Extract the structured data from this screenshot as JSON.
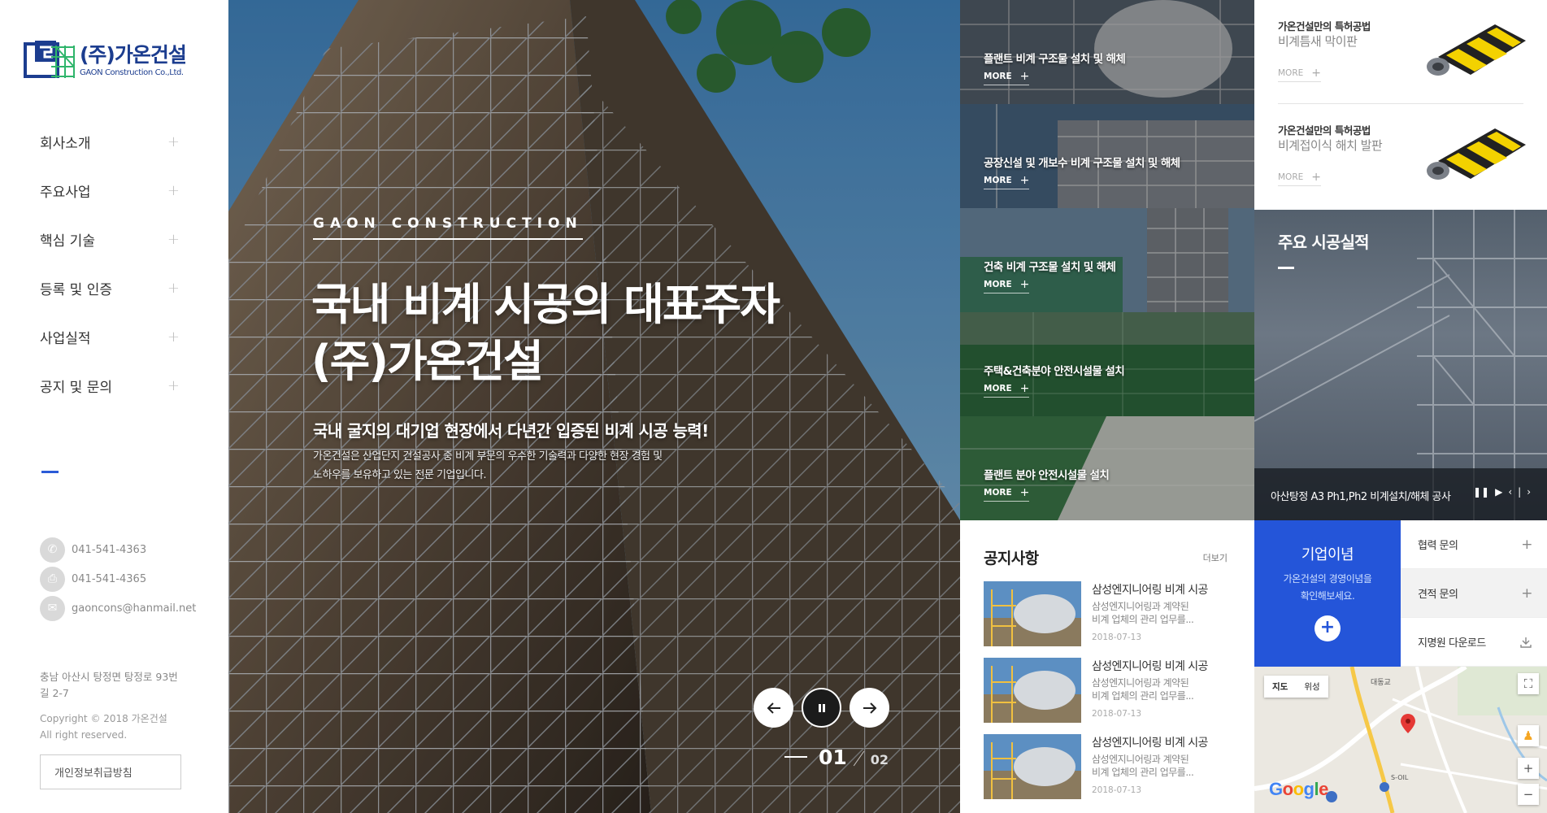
{
  "logo": {
    "name_kr": "(주)가온건설",
    "name_en": "GAON Construction Co.,Ltd."
  },
  "nav": [
    {
      "label": "회사소개"
    },
    {
      "label": "주요사업"
    },
    {
      "label": "핵심 기술"
    },
    {
      "label": "등록 및 인증"
    },
    {
      "label": "사업실적"
    },
    {
      "label": "공지 및 문의"
    }
  ],
  "contacts": {
    "phone": "041-541-4363",
    "fax": "041-541-4365",
    "email": "gaoncons@hanmail.net"
  },
  "address": "충남 아산시 탕정면 탕정로 93번길 2-7",
  "copyright": {
    "line1": "Copyright © 2018 가온건설",
    "line2": "All right reserved."
  },
  "privacy_label": "개인정보취급방침",
  "hero": {
    "subtitle": "GAON CONSTRUCTION",
    "title_line1": "국내 비계 시공의 대표주자",
    "title_line2": "(주)가온건설",
    "lead": "국내 굴지의 대기업 현장에서 다년간 입증된 비계 시공 능력!",
    "desc_line1": "가온건설은 산업단지 건설공사 중 비계 부문의 우수한 기술력과 다양한 현장 경험 및",
    "desc_line2": "노하우를 보유하고 있는 전문 기업입니다.",
    "current": "01",
    "total": "02"
  },
  "tiles": [
    {
      "title": "플랜트 비계 구조물 설치 및 해체",
      "more": "MORE"
    },
    {
      "title": "공장신설 및 개보수 비계 구조물 설치 및 해체",
      "more": "MORE"
    },
    {
      "title": "건축 비계 구조물 설치 및 해체",
      "more": "MORE"
    },
    {
      "title": "주택&건축분야 안전시설물 설치",
      "more": "MORE"
    },
    {
      "title": "플랜트 분야 안전시설물 설치",
      "more": "MORE"
    }
  ],
  "patents": [
    {
      "caption": "가온건설만의 특허공법",
      "title": "비계틈새 막이판",
      "more": "MORE"
    },
    {
      "caption": "가온건설만의 특허공법",
      "title": "비계접이식 해치 발판",
      "more": "MORE"
    }
  ],
  "projects": {
    "title": "주요 시공실적",
    "caption": "아산탕정 A3 Ph1,Ph2 비계설치/해체 공사"
  },
  "notice": {
    "title": "공지사항",
    "more": "더보기",
    "items": [
      {
        "title": "삼성엔지니어링 비계 시공",
        "summary_line1": "삼성엔지니어링과 계약된",
        "summary_line2": "비계 업체의 관리 업무를...",
        "date": "2018-07-13"
      },
      {
        "title": "삼성엔지니어링 비계 시공",
        "summary_line1": "삼성엔지니어링과 계약된",
        "summary_line2": "비계 업체의 관리 업무를...",
        "date": "2018-07-13"
      },
      {
        "title": "삼성엔지니어링 비계 시공",
        "summary_line1": "삼성엔지니어링과 계약된",
        "summary_line2": "비계 업체의 관리 업무를...",
        "date": "2018-07-13"
      }
    ]
  },
  "philosophy": {
    "title": "기업이념",
    "desc_line1": "가온건설의 경영이념을",
    "desc_line2": "확인해보세요."
  },
  "links": [
    {
      "label": "협력 문의"
    },
    {
      "label": "견적 문의"
    },
    {
      "label": "지명원 다운로드"
    }
  ],
  "map": {
    "type_map": "지도",
    "type_satellite": "위성",
    "label_1": "대동교",
    "label_2": "S-OIL"
  },
  "colors": {
    "brand_blue": "#2455d9",
    "logo_navy": "#1c3d8f"
  }
}
